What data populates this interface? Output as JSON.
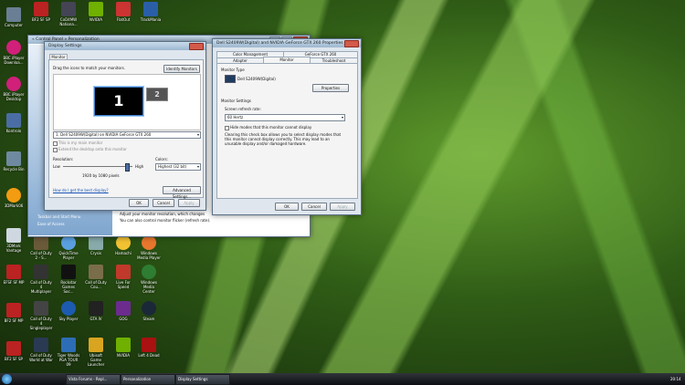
{
  "desktop": {
    "icons": [
      {
        "label": "Computer",
        "color": "#6a7f94"
      },
      {
        "label": "BBC iPlayer Downloa...",
        "color": "#d0207a"
      },
      {
        "label": "BBC iPlayer Desktop",
        "color": "#d0207a"
      },
      {
        "label": "Kontrolo",
        "color": "#4a6ea3"
      },
      {
        "label": "Recycle Bin",
        "color": "#6f8aa0"
      },
      {
        "label": "3DMark06",
        "color": "#f39c12"
      },
      {
        "label": "3DMark Vantage",
        "color": "#cfd8e0"
      },
      {
        "label": "EFSF SF MP",
        "color": "#b22"
      },
      {
        "label": "BF2 SF MP",
        "color": "#b22"
      },
      {
        "label": "BF2 SF SP",
        "color": "#b22"
      }
    ],
    "top_icons": [
      "BF2 SF SP",
      "CoD4MW Nationa...",
      "NVIDIA",
      "FlatOut",
      "TrackMania"
    ],
    "grid_icons": [
      "Call of Duty 2 - S...",
      "QuickTime Player",
      "Crysis",
      "Hamachi",
      "Windows Media Player",
      "Call of Duty 4 Multiplayer",
      "Rockstar Games Soc...",
      "Call of Duty Cou...",
      "Live For Speed",
      "Windows Media Center",
      "Call of Duty 4 Singleplayer",
      "Sky Player",
      "GTA IV",
      "GOG",
      "Steam",
      "Call of Duty World at War",
      "Tiger Woods PGA TOUR 09",
      "Ubisoft Game Launcher",
      "NVIDIA",
      "Left 4 Dead"
    ]
  },
  "control_panel": {
    "title": "« Control Panel » Personalization",
    "text1": "Adjust your monitor resolution, which changes",
    "text2": "You can also control monitor flicker (refresh rate).",
    "side1": "Taskbar and Start Menu",
    "side2": "Ease of Access"
  },
  "display_settings": {
    "title": "Display Settings",
    "tab": "Monitor",
    "drag_text": "Drag the icons to match your monitors.",
    "identify_button": "Identify Monitors",
    "monitor1": "1",
    "monitor2": "2",
    "monitor_select": "1. Dell S2409W(Digital) on NVIDIA GeForce GTX 260",
    "check_main": "This is my main monitor",
    "check_extend": "Extend the desktop onto this monitor",
    "resolution_label": "Resolution:",
    "low": "Low",
    "high": "High",
    "resolution_value": "1920 by 1080 pixels",
    "slider_level": 0.92,
    "colors_label": "Colors:",
    "colors_value": "Highest (32 bit)",
    "help_link": "How do I get the best display?",
    "advanced_button": "Advanced Settings...",
    "ok": "OK",
    "cancel": "Cancel",
    "apply": "Apply"
  },
  "properties": {
    "title": "Dell S2409W(Digital) and NVIDIA GeForce GTX 260 Properties",
    "tabs_top": [
      "Color Management",
      "GeForce GTX 260"
    ],
    "tabs_bottom": [
      "Adapter",
      "Monitor",
      "Troubleshoot"
    ],
    "monitor_type_label": "Monitor Type",
    "monitor_name": "Dell S2409W(Digital)",
    "properties_button": "Properties",
    "monitor_settings_label": "Monitor Settings",
    "refresh_label": "Screen refresh rate:",
    "refresh_value": "60 Hertz",
    "hide_modes": "Hide modes that this monitor cannot display",
    "hide_desc": "Clearing this check box allows you to select display modes that this monitor cannot display correctly. This may lead to an unusable display and/or damaged hardware.",
    "ok": "OK",
    "cancel": "Cancel",
    "apply": "Apply"
  },
  "taskbar": {
    "items": [
      "Vista Forums - Repl...",
      "Personalization",
      "Display Settings"
    ],
    "clock": "20:14"
  }
}
